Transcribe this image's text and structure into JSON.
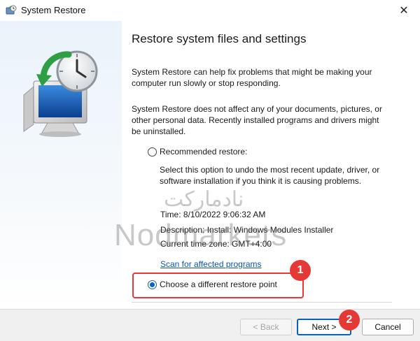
{
  "window": {
    "title": "System Restore",
    "close_glyph": "✕",
    "app_icon": "system-restore-icon"
  },
  "left_panel": {
    "hero_icon": "computer-clock-restore-icon"
  },
  "content": {
    "heading": "Restore system files and settings",
    "paragraph1": "System Restore can help fix problems that might be making your computer run slowly or stop responding.",
    "paragraph2": "System Restore does not affect any of your documents, pictures, or other personal data. Recently installed programs and drivers might be uninstalled.",
    "recommended_label": "Recommended restore:",
    "recommended_desc": "Select this option to undo the most recent update, driver, or software installation if you think it is causing problems.",
    "time_line": "Time: 8/10/2022 9:06:32 AM",
    "description_line": "Description: Install: Windows Modules Installer",
    "timezone_line": "Current time zone: GMT+4:00",
    "scan_link": "Scan for affected programs",
    "choose_label": "Choose a different restore point",
    "selected_option": "choose"
  },
  "annotations": {
    "badge1": "1",
    "badge2": "2",
    "highlight_color": "#e53935"
  },
  "watermark": {
    "persian": "نادمارکت",
    "latin": "Nodmarkets"
  },
  "footer": {
    "back_label": "< Back",
    "next_label": "Next >",
    "cancel_label": "Cancel"
  },
  "colors": {
    "accent": "#0a60c0",
    "link": "#0a55b5"
  }
}
